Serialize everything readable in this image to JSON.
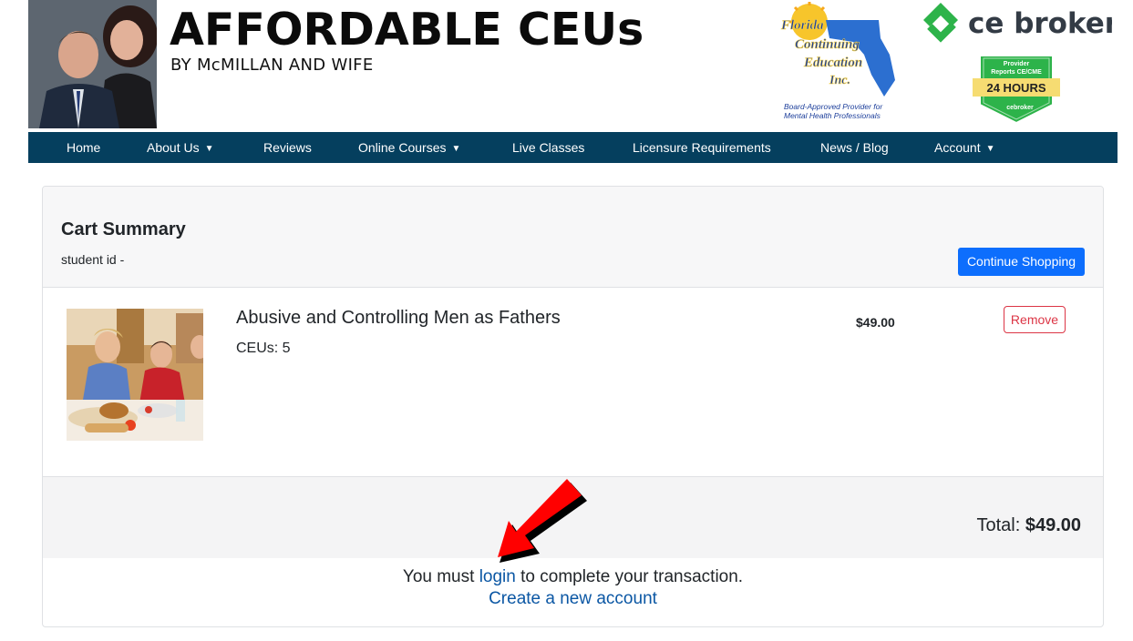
{
  "header": {
    "title": "AFFORDABLE CEUs",
    "subtitle": "BY McMILLAN AND WIFE",
    "fce_logo": {
      "line1": "Florida",
      "line2": "Continuing",
      "line3": "Education",
      "line4": "Inc.",
      "caption1": "Board-Approved Provider for",
      "caption2": "Mental Health Professionals"
    },
    "cebroker": {
      "name": "ce broker",
      "badge_line1": "Provider",
      "badge_line2": "Reports CE/CME",
      "badge_hours": "24 HOURS",
      "badge_brand": "cebroker"
    }
  },
  "nav": {
    "home": "Home",
    "about": "About Us",
    "reviews": "Reviews",
    "online_courses": "Online Courses",
    "live_classes": "Live Classes",
    "licensure": "Licensure Requirements",
    "news": "News / Blog",
    "account": "Account",
    "chevron": "⌵"
  },
  "cart": {
    "title": "Cart Summary",
    "student_id": "student id -",
    "continue_label": "Continue Shopping",
    "item": {
      "title": "Abusive and Controlling Men as Fathers",
      "ceus": "CEUs: 5",
      "price": "$49.00",
      "remove_label": "Remove"
    },
    "total_label": "Total:",
    "total_value": "$49.00",
    "login_prefix": "You must",
    "login_link": "login",
    "login_suffix": "to complete your transaction.",
    "create_account": "Create a new account"
  },
  "colors": {
    "nav_bg": "#053f5e",
    "primary": "#0d6efd",
    "danger": "#dc3545",
    "link": "#0b57a4",
    "arrow": "#ff0000"
  }
}
